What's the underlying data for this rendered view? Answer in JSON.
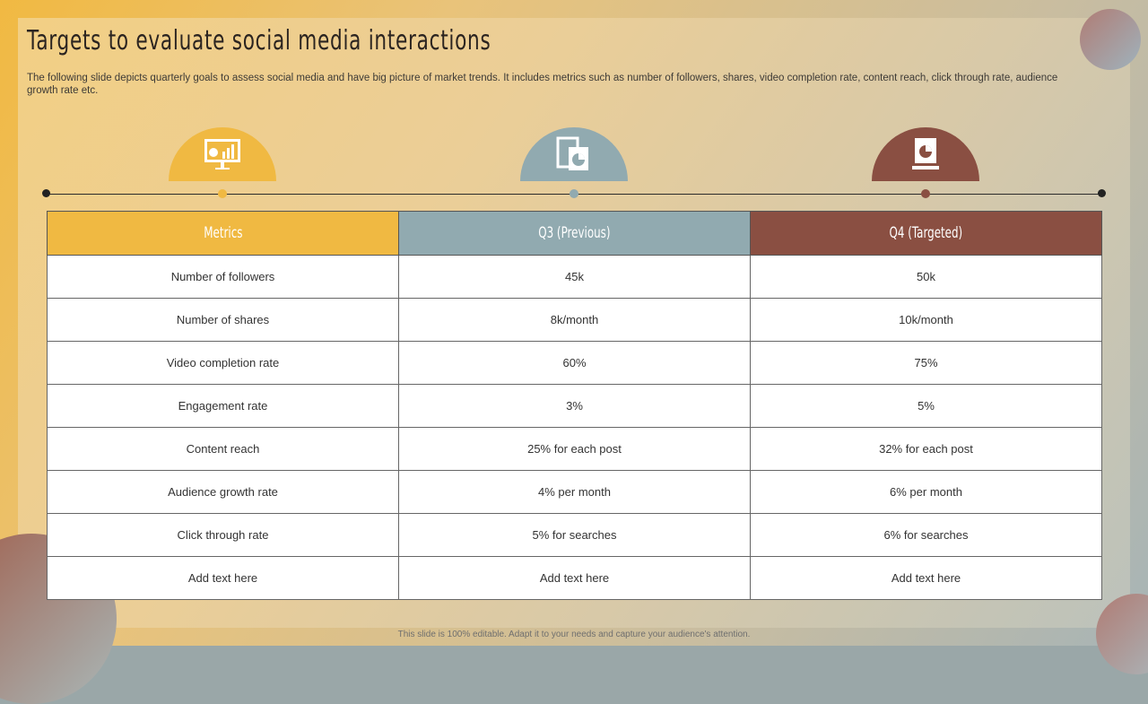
{
  "title": "Targets to evaluate social media interactions",
  "description": "The following slide depicts quarterly goals to assess social media and have big picture of market trends. It includes metrics such as number of followers, shares, video completion rate, content reach, click through rate, audience growth rate etc.",
  "colors": {
    "metrics": "#f0b942",
    "previous": "#91aab0",
    "targeted": "#8a4f42"
  },
  "table": {
    "headers": [
      "Metrics",
      "Q3 (Previous)",
      "Q4 (Targeted)"
    ],
    "rows": [
      [
        "Number of followers",
        "45k",
        "50k"
      ],
      [
        "Number of shares",
        "8k/month",
        "10k/month"
      ],
      [
        "Video completion rate",
        "60%",
        "75%"
      ],
      [
        "Engagement rate",
        "3%",
        "5%"
      ],
      [
        "Content reach",
        "25% for each post",
        "32% for each post"
      ],
      [
        "Audience growth rate",
        "4% per month",
        "6% per month"
      ],
      [
        "Click through rate",
        "5% for searches",
        "6% for searches"
      ],
      [
        "Add text here",
        "Add text here",
        "Add text here"
      ]
    ]
  },
  "footer": "This slide is 100% editable. Adapt it to your needs and capture your audience's attention."
}
